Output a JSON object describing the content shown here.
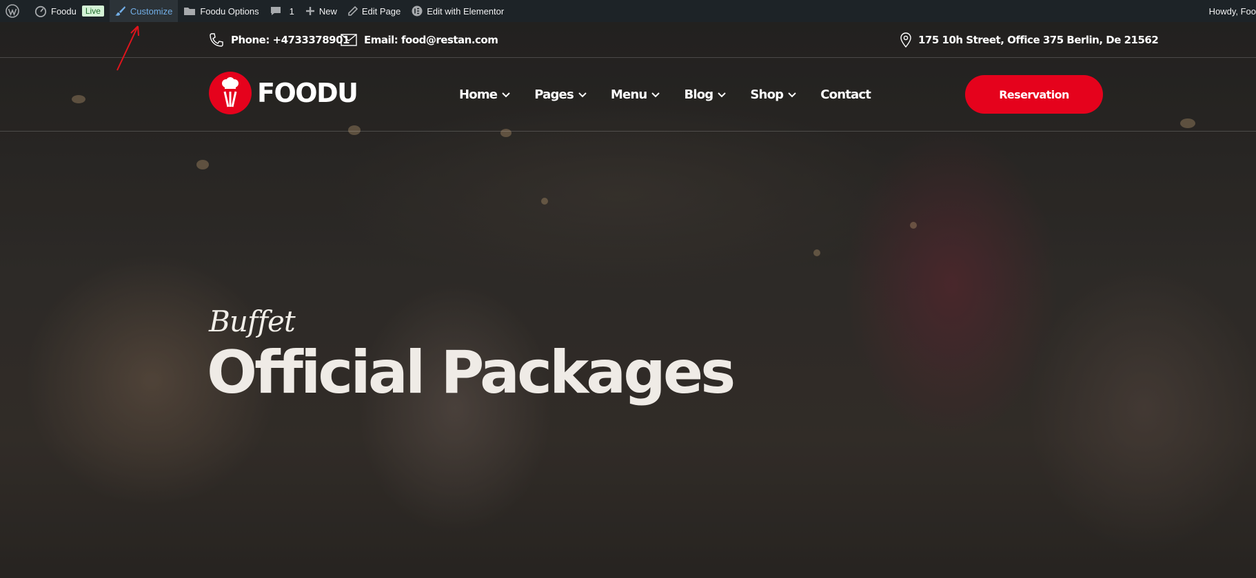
{
  "adminbar": {
    "site_name": "Foodu",
    "live_badge": "Live",
    "customize": "Customize",
    "options": "Foodu Options",
    "comments_count": "1",
    "new": "New",
    "edit_page": "Edit Page",
    "elementor": "Edit with Elementor",
    "howdy": "Howdy, Foo"
  },
  "topbar": {
    "phone": "Phone: +4733378901",
    "email": "Email: food@restan.com",
    "address": "175 10h Street, Office 375 Berlin, De 21562"
  },
  "header": {
    "logo_text": "FOODU",
    "nav": [
      "Home",
      "Pages",
      "Menu",
      "Blog",
      "Shop",
      "Contact"
    ],
    "reservation": "Reservation"
  },
  "hero": {
    "subtitle": "Buffet",
    "title": "Official Packages"
  },
  "colors": {
    "brand_red": "#e5021c",
    "admin_bar": "#1d2327",
    "customize_link": "#72aee6"
  }
}
